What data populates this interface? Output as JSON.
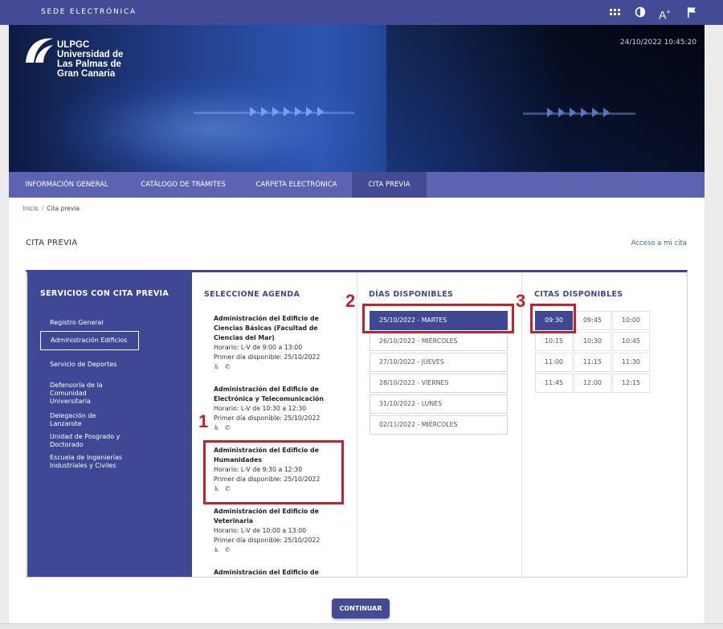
{
  "topbar": {
    "title": "SEDE ELECTRÓNICA",
    "icons": [
      "apps-grid-icon",
      "contrast-icon",
      "text-size-icon",
      "flag-icon"
    ],
    "text_size_glyph": "A",
    "text_size_sup": "+"
  },
  "header": {
    "logo_lines": [
      "ULPGC",
      "Universidad de",
      "Las Palmas de",
      "Gran Canaria"
    ],
    "datetime": "24/10/2022 10:45:20"
  },
  "nav": {
    "items": [
      "INFORMACIÓN GENERAL",
      "CATÁLOGO DE TRÁMITES",
      "CARPETA ELECTRÓNICA",
      "CITA PREVIA"
    ],
    "active": "CITA PREVIA"
  },
  "breadcrumb": {
    "home": "Inicio",
    "current": "Cita previa"
  },
  "page": {
    "title": "CITA PREVIA",
    "my_appointment_link": "Acceso a mi cita"
  },
  "services": {
    "title": "SERVICIOS CON CITA PREVIA",
    "items": [
      "Registro General",
      "Administración Edificios",
      "Servicio de Deportes",
      "Defensoría de la Comunidad Universitaria",
      "Delegación de Lanzarote",
      "Unidad de Posgrado y Doctorado",
      "Escuela de Ingenierías Industriales y Civiles"
    ],
    "selected": "Administración Edificios"
  },
  "agenda": {
    "title": "SELECCIONE AGENDA",
    "items": [
      {
        "name": "Administración del Edificio de Ciencias Básicas (Facultad de Ciencias del Mar)",
        "hours": "Horario: L-V de 9:00 a 13:00",
        "first_day": "Primer día disponible: 25/10/2022"
      },
      {
        "name": "Administración del Edificio de Electrónica y Telecomunicación",
        "hours": "Horario: L-V de 10:30 a 12:30",
        "first_day": "Primer día disponible: 25/10/2022"
      },
      {
        "name": "Administración del Edificio de Humanidades",
        "hours": "Horario: L-V de 9:30 a 12:30",
        "first_day": "Primer día disponible: 25/10/2022"
      },
      {
        "name": "Administración del Edificio de Veterinaria",
        "hours": "Horario: L-V de 10:00 a 13:00",
        "first_day": "Primer día disponible: 25/10/2022"
      },
      {
        "name": "Administración del Edificio de",
        "hours": "",
        "first_day": ""
      }
    ],
    "icon_glyphs": "♿ ✆",
    "selected_index": 2
  },
  "days": {
    "title": "DÍAS DISPONIBLES",
    "items": [
      "25/10/2022 - MARTES",
      "26/10/2022 - MIÉRCOLES",
      "27/10/2022 - JUEVES",
      "28/10/2022 - VIERNES",
      "31/10/2022 - LUNES",
      "02/11/2022 - MIÉRCOLES"
    ],
    "selected": "25/10/2022 - MARTES"
  },
  "times": {
    "title": "CITAS DISPONIBLES",
    "items": [
      "09:30",
      "09:45",
      "10:00",
      "10:15",
      "10:30",
      "10:45",
      "11:00",
      "11:15",
      "11:30",
      "11:45",
      "12:00",
      "12:15"
    ],
    "selected": "09:30"
  },
  "annotations": [
    "1",
    "2",
    "3"
  ],
  "continue_label": "CONTINUAR",
  "colors": {
    "primary": "#434b95",
    "nav": "#5c63b0",
    "annotation": "#c3212c",
    "link": "#3a6ab0"
  }
}
